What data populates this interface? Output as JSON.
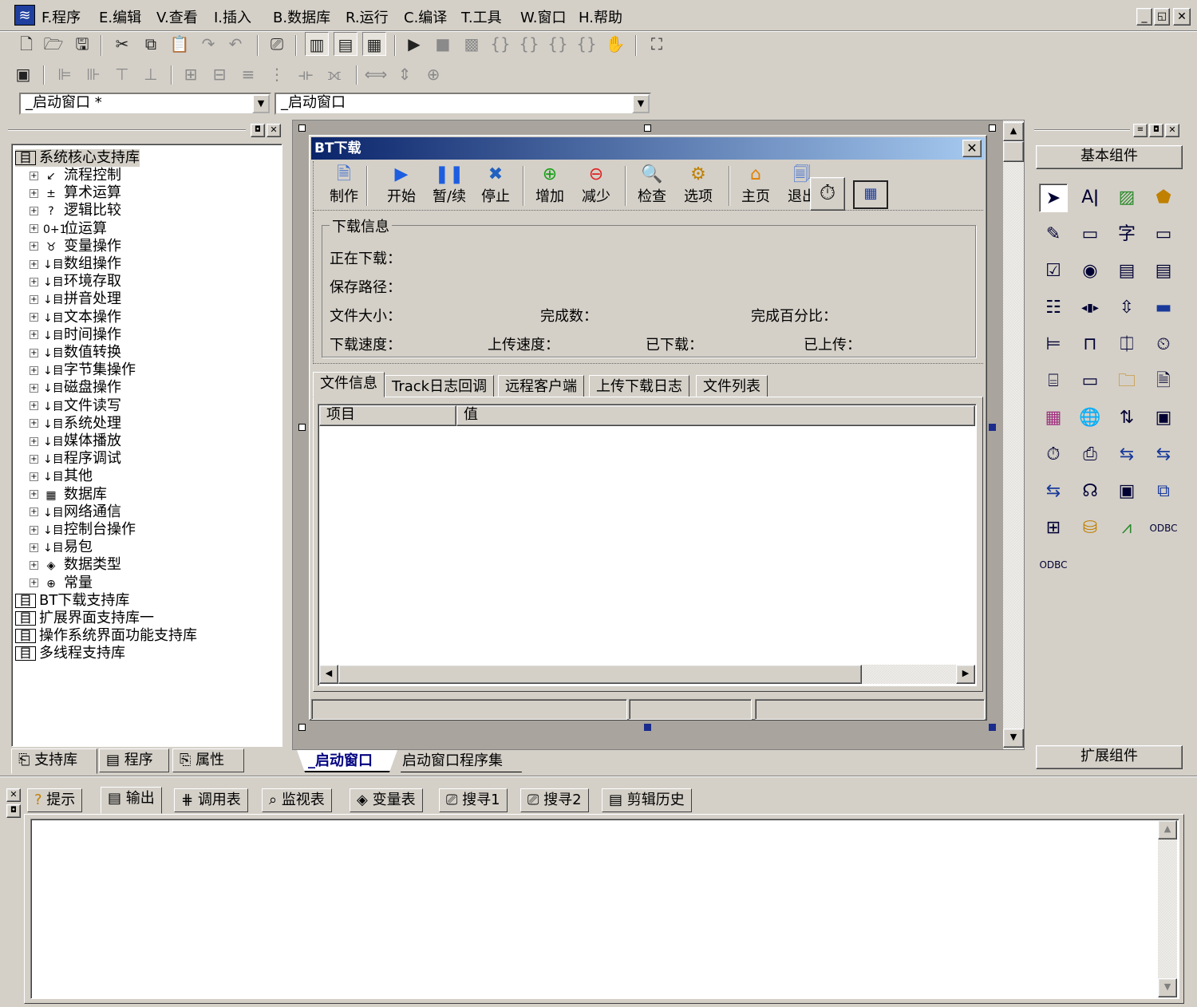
{
  "app": {
    "icon": "app-logo-icon"
  },
  "menu": [
    "F.程序",
    "E.编辑",
    "V.查看",
    "I.插入",
    "B.数据库",
    "R.运行",
    "C.编译",
    "T.工具",
    "W.窗口",
    "H.帮助"
  ],
  "window_controls": {
    "minimize": "_",
    "restore": "◱",
    "close": "✕"
  },
  "toolbar1": [
    "new-file-icon",
    "open-folder-icon",
    "save-icon",
    "cut-icon",
    "copy-icon",
    "paste-icon",
    "redo-icon",
    "undo-icon",
    "find-icon",
    "layout-1-icon",
    "layout-2-icon",
    "layout-3-icon",
    "run-icon",
    "stop-icon",
    "debug-1-icon",
    "debug-2-icon",
    "debug-3-icon",
    "debug-4-icon",
    "debug-5-icon",
    "hand-icon",
    "binoculars-icon"
  ],
  "combos": {
    "left": "_启动窗口 *",
    "right": "_启动窗口"
  },
  "tree": {
    "root": "系统核心支持库",
    "children": [
      "流程控制",
      "算术运算",
      "逻辑比较",
      "位运算",
      "变量操作",
      "数组操作",
      "环境存取",
      "拼音处理",
      "文本操作",
      "时间操作",
      "数值转换",
      "字节集操作",
      "磁盘操作",
      "文件读写",
      "系统处理",
      "媒体播放",
      "程序调试",
      "其他",
      "数据库",
      "网络通信",
      "控制台操作",
      "易包",
      "数据类型",
      "常量"
    ],
    "icons": [
      "↙",
      "±",
      "?",
      "0+1",
      "♉",
      "↓目",
      "↓目",
      "↓目",
      "↓目",
      "↓目",
      "↓目",
      "↓目",
      "↓目",
      "↓目",
      "↓目",
      "↓目",
      "↓目",
      "↓目",
      "▦",
      "↓目",
      "↓目",
      "↓目",
      "◈",
      "⊕"
    ],
    "libs": [
      "BT下载支持库",
      "扩展界面支持库一",
      "操作系统界面功能支持库",
      "多线程支持库"
    ]
  },
  "left_tabs": [
    "支持库",
    "程序",
    "属性"
  ],
  "design": {
    "title": "BT下载",
    "toolbar": [
      {
        "label": "制作",
        "icon": "🗎"
      },
      {
        "label": "开始",
        "icon": "▶"
      },
      {
        "label": "暂/续",
        "icon": "❚❚"
      },
      {
        "label": "停止",
        "icon": "✖"
      },
      {
        "label": "增加",
        "icon": "⊕"
      },
      {
        "label": "减少",
        "icon": "⊖"
      },
      {
        "label": "检查",
        "icon": "🔍"
      },
      {
        "label": "选项",
        "icon": "⚙"
      },
      {
        "label": "主页",
        "icon": "⌂"
      },
      {
        "label": "退出",
        "icon": "🗐"
      }
    ],
    "group_title": "下载信息",
    "fields": {
      "downloading": "正在下载：",
      "save_path": "保存路径：",
      "file_size": "文件大小：",
      "completed": "完成数：",
      "percent": "完成百分比：",
      "dl_speed": "下载速度：",
      "ul_speed": "上传速度：",
      "downloaded": "已下载：",
      "uploaded": "已上传："
    },
    "tabs": [
      "文件信息",
      "Track日志回调",
      "远程客户端",
      "上传下载日志",
      "文件列表"
    ],
    "columns": [
      "项目",
      "值"
    ]
  },
  "design_tabs": [
    "_启动窗口",
    "启动窗口程序集"
  ],
  "palette": {
    "top": "基本组件",
    "bottom": "扩展组件"
  },
  "bottom_tabs": [
    "提示",
    "输出",
    "调用表",
    "监视表",
    "变量表",
    "搜寻1",
    "搜寻2",
    "剪辑历史"
  ]
}
